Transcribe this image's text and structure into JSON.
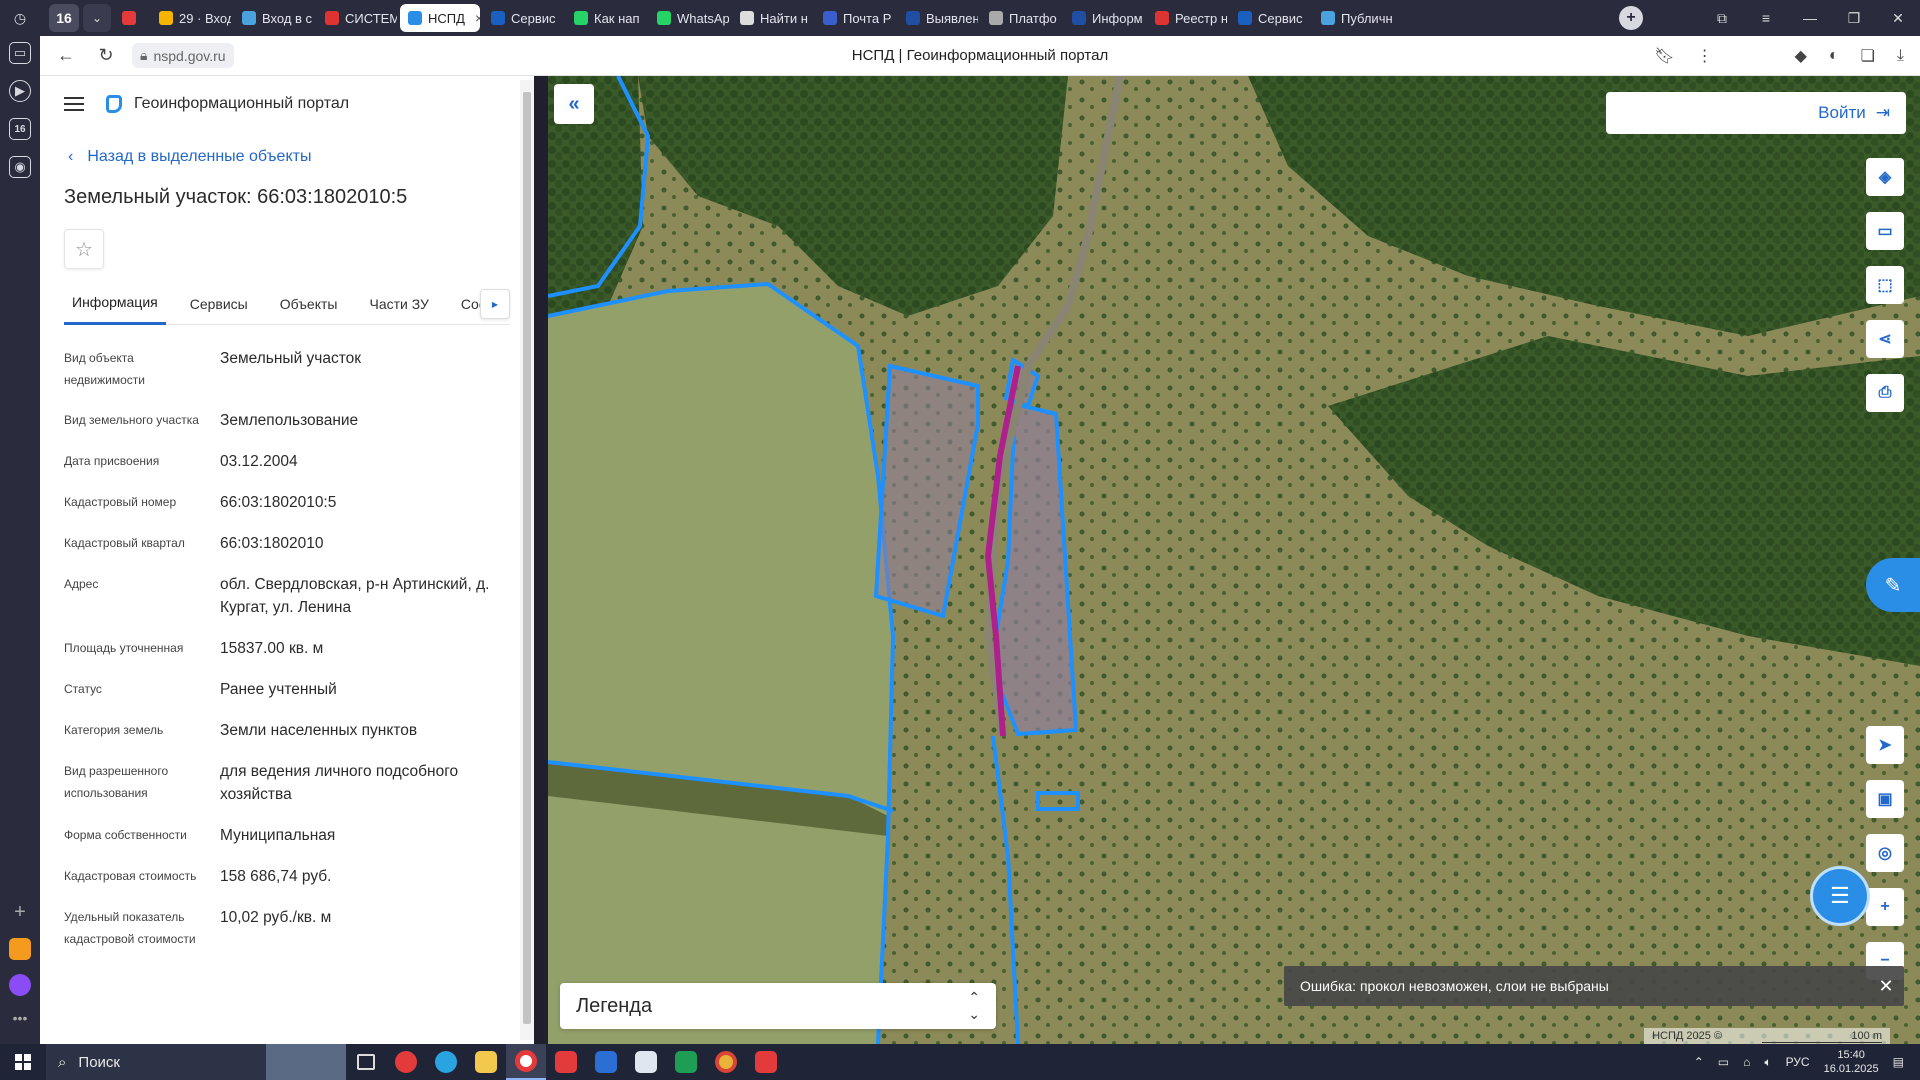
{
  "browser": {
    "tab_count": "16",
    "tabs": [
      {
        "label": "",
        "color": "#e33b3b"
      },
      {
        "label": "29 · Вход",
        "color": "#f5b400"
      },
      {
        "label": "Вход в с",
        "color": "#4aa3df"
      },
      {
        "label": "СИСТЕМ",
        "color": "#d33"
      },
      {
        "label": "НСПД",
        "color": "#2b8ee6",
        "active": true
      },
      {
        "label": "Сервис",
        "color": "#1b5fbf"
      },
      {
        "label": "Как нап",
        "color": "#25d366"
      },
      {
        "label": "WhatsAp",
        "color": "#25d366"
      },
      {
        "label": "Найти н",
        "color": "#dddddd"
      },
      {
        "label": "Почта Р",
        "color": "#3a5fcd"
      },
      {
        "label": "Выявлен",
        "color": "#1f4ea3"
      },
      {
        "label": "Платфо",
        "color": "#aaaaaa"
      },
      {
        "label": "Информ",
        "color": "#1f4ea3"
      },
      {
        "label": "Реестр н",
        "color": "#d33"
      },
      {
        "label": "Сервис",
        "color": "#1b5fbf"
      },
      {
        "label": "Публичн",
        "color": "#4aa3df"
      }
    ],
    "url": "nspd.gov.ru",
    "page_title": "НСПД | Геоинформационный портал"
  },
  "panel": {
    "portal_name": "Геоинформационный портал",
    "back_label": "Назад в выделенные объекты",
    "object_title": "Земельный участок: 66:03:1802010:5",
    "tabs": [
      "Информация",
      "Сервисы",
      "Объекты",
      "Части ЗУ",
      "Соста"
    ],
    "properties": [
      {
        "key": "Вид объекта недвижимости",
        "value": "Земельный участок"
      },
      {
        "key": "Вид земельного участка",
        "value": "Землепользование"
      },
      {
        "key": "Дата присвоения",
        "value": "03.12.2004"
      },
      {
        "key": "Кадастровый номер",
        "value": "66:03:1802010:5"
      },
      {
        "key": "Кадастровый квартал",
        "value": "66:03:1802010"
      },
      {
        "key": "Адрес",
        "value": "обл. Свердловская, р-н Артинский, д. Кургат, ул. Ленина"
      },
      {
        "key": "Площадь уточненная",
        "value": "15837.00 кв. м"
      },
      {
        "key": "Статус",
        "value": "Ранее учтенный"
      },
      {
        "key": "Категория земель",
        "value": "Земли населенных пунктов"
      },
      {
        "key": "Вид разрешенного использования",
        "value": "для ведения личного подсобного хозяйства"
      },
      {
        "key": "Форма собственности",
        "value": "Муниципальная"
      },
      {
        "key": "Кадастровая стоимость",
        "value": "158 686,74 руб."
      },
      {
        "key": "Удельный показатель кадастровой стоимости",
        "value": "10,02 руб./кв. м"
      }
    ]
  },
  "map": {
    "login_label": "Войти",
    "legend_label": "Легенда",
    "toast_text": "Ошибка: прокол невозможен, слои не выбраны",
    "attribution": "НСПД 2025 ©",
    "scale_label": "100 m",
    "colors": {
      "parcel_border": "#1e90ff",
      "road": "#b0208c",
      "accent": "#2468c9"
    }
  },
  "taskbar": {
    "search_label": "Поиск",
    "lang": "РУС",
    "time": "15:40",
    "date": "16.01.2025"
  }
}
